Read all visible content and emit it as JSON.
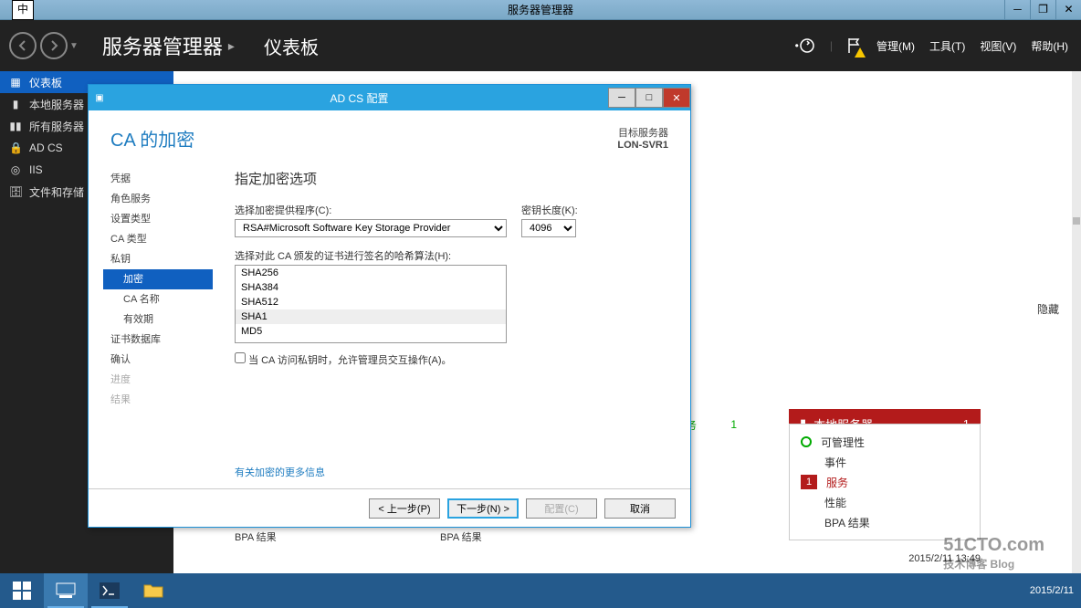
{
  "window": {
    "title": "服务器管理器",
    "ime": "中"
  },
  "header": {
    "crumb1": "服务器管理器",
    "crumb2": "仪表板",
    "menu": {
      "manage": "管理(M)",
      "tools": "工具(T)",
      "view": "视图(V)",
      "help": "帮助(H)"
    }
  },
  "sidebar": {
    "items": [
      {
        "label": "仪表板"
      },
      {
        "label": "本地服务器"
      },
      {
        "label": "所有服务器"
      },
      {
        "label": "AD CS"
      },
      {
        "label": "IIS"
      },
      {
        "label": "文件和存储"
      }
    ]
  },
  "main": {
    "hide": "隐藏"
  },
  "tile": {
    "svc_label": "服务",
    "svc_count": "1",
    "red_title": "本地服务器",
    "red_count": "1",
    "rows": {
      "manage": "可管理性",
      "events": "事件",
      "services": "服务",
      "services_badge": "1",
      "perf": "性能",
      "bpa": "BPA 结果"
    }
  },
  "bpa_label": "BPA 结果",
  "dialog": {
    "title": "AD CS 配置",
    "heading": "CA 的加密",
    "target_label": "目标服务器",
    "target_value": "LON-SVR1",
    "steps": {
      "cred": "凭据",
      "role": "角色服务",
      "setup": "设置类型",
      "catype": "CA 类型",
      "pkey": "私钥",
      "crypto": "加密",
      "caname": "CA 名称",
      "validity": "有效期",
      "certdb": "证书数据库",
      "confirm": "确认",
      "progress": "进度",
      "result": "结果"
    },
    "section_title": "指定加密选项",
    "provider_label": "选择加密提供程序(C):",
    "provider_value": "RSA#Microsoft Software Key Storage Provider",
    "keylen_label": "密钥长度(K):",
    "keylen_value": "4096",
    "hash_label": "选择对此 CA 颁发的证书进行签名的哈希算法(H):",
    "hash": {
      "sha256": "SHA256",
      "sha384": "SHA384",
      "sha512": "SHA512",
      "sha1": "SHA1",
      "md5": "MD5"
    },
    "allow_interact": "当 CA 访问私钥时，允许管理员交互操作(A)。",
    "more_link": "有关加密的更多信息",
    "buttons": {
      "prev": "< 上一步(P)",
      "next": "下一步(N) >",
      "config": "配置(C)",
      "cancel": "取消"
    }
  },
  "taskbar": {
    "date": "2015/2/11"
  },
  "watermark": {
    "brand": "51CTO.com",
    "sub": "技术博客  Blog",
    "ts": "2015/2/11 13:49"
  }
}
